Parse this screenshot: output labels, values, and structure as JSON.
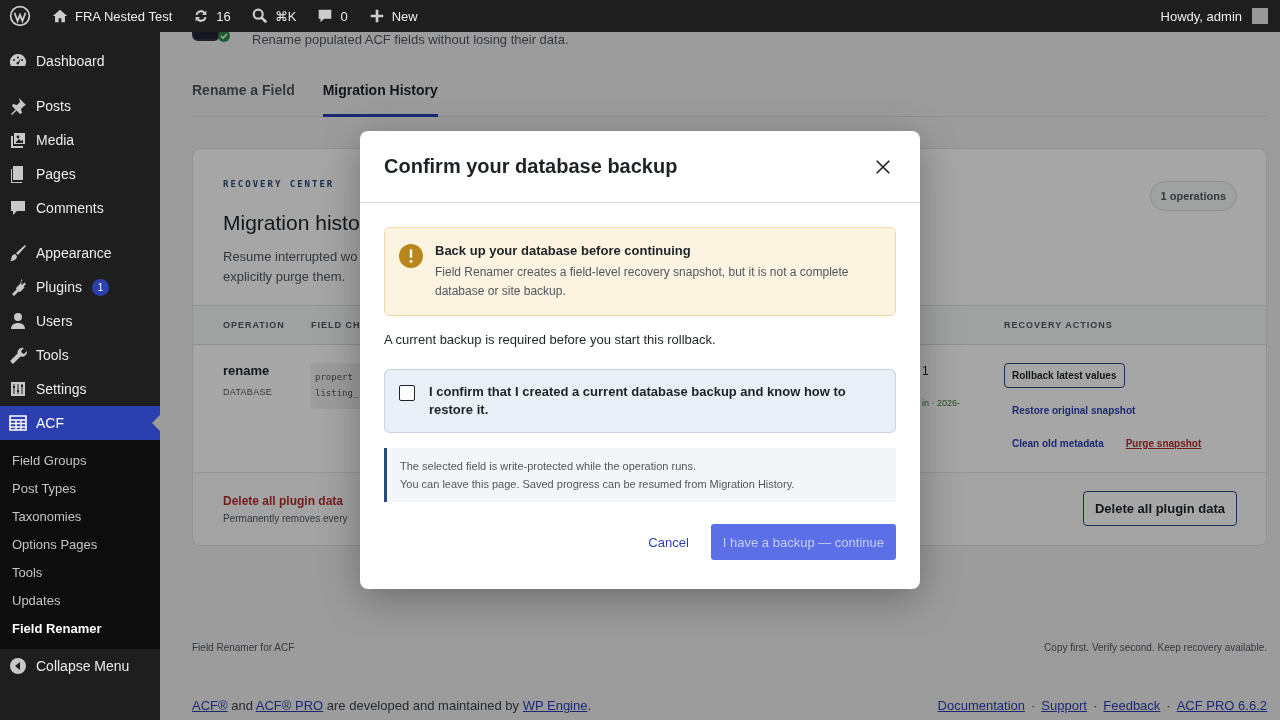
{
  "admin_bar": {
    "site_name": "FRA Nested Test",
    "updates": "16",
    "shortcut": "⌘K",
    "comments": "0",
    "new_label": "New",
    "greeting": "Howdy, admin"
  },
  "sidebar": {
    "groups": [
      [
        {
          "label": "Dashboard",
          "selected": false
        }
      ],
      [
        {
          "label": "Posts",
          "selected": false
        },
        {
          "label": "Media",
          "selected": false
        },
        {
          "label": "Pages",
          "selected": false
        },
        {
          "label": "Comments",
          "selected": false
        }
      ],
      [
        {
          "label": "Appearance",
          "selected": false
        },
        {
          "label": "Plugins",
          "selected": false,
          "badge": "1"
        },
        {
          "label": "Users",
          "selected": false
        },
        {
          "label": "Tools",
          "selected": false
        },
        {
          "label": "Settings",
          "selected": false
        },
        {
          "label": "ACF",
          "selected": true
        }
      ]
    ],
    "submenu": [
      {
        "label": "Field Groups",
        "selected": false
      },
      {
        "label": "Post Types",
        "selected": false
      },
      {
        "label": "Taxonomies",
        "selected": false
      },
      {
        "label": "Options Pages",
        "selected": false
      },
      {
        "label": "Tools",
        "selected": false
      },
      {
        "label": "Updates",
        "selected": false
      },
      {
        "label": "Field Renamer",
        "selected": true
      }
    ],
    "collapse_label": "Collapse Menu"
  },
  "page": {
    "subtitle": "Rename populated ACF fields without losing their data.",
    "tabs": [
      {
        "label": "Rename a Field",
        "selected": false
      },
      {
        "label": "Migration History",
        "selected": true
      }
    ],
    "card": {
      "eyebrow": "RECOVERY CENTER",
      "count": "1 operations",
      "title": "Migration histo",
      "description": [
        "Resume interrupted wo",
        "explicitly purge them."
      ],
      "columns": [
        "OPERATION",
        "FIELD CH",
        "",
        "RECOVERY ACTIONS"
      ],
      "rows": [
        {
          "operation": "rename",
          "storage": "DATABASE",
          "fields": [
            "propert",
            "listing_"
          ],
          "column_3": [
            {
              "text": "1",
              "kind": "plain"
            },
            {
              "text": "in · 2026-",
              "kind": "success"
            }
          ],
          "actions": [
            {
              "label": "Rollback latest values",
              "kind": "outline"
            },
            {
              "label": "Restore original snapshot",
              "kind": "link"
            },
            {
              "label": "Clean old metadata",
              "kind": "link"
            },
            {
              "label": "Purge snapshot",
              "kind": "danger"
            }
          ]
        }
      ],
      "danger_zone": {
        "title": "Delete all plugin data",
        "text": "Permanently removes every",
        "button": "Delete all plugin data"
      }
    },
    "footer": {
      "left": "Field Renamer for ACF",
      "right": "Copy first. Verify second. Keep recovery available."
    }
  },
  "credits": [
    {
      "text": "ACF®",
      "link": true
    },
    {
      "text": " and ",
      "link": false
    },
    {
      "text": "ACF® PRO",
      "link": true
    },
    {
      "text": " are developed and maintained by ",
      "link": false
    },
    {
      "text": "WP Engine",
      "link": true
    },
    {
      "text": ".",
      "link": false
    }
  ],
  "links": [
    {
      "text": "Documentation",
      "kind": "link"
    },
    {
      "text": "·",
      "kind": "sep"
    },
    {
      "text": "Support",
      "kind": "link"
    },
    {
      "text": "·",
      "kind": "sep"
    },
    {
      "text": "Feedback",
      "kind": "link"
    },
    {
      "text": "·",
      "kind": "sep"
    },
    {
      "text": "ACF PRO 6.6.2",
      "kind": "link"
    }
  ],
  "modal": {
    "title": "Confirm your database backup",
    "notice": {
      "title": "Back up your database before continuing",
      "text": "Field Renamer creates a field-level recovery snapshot, but it is not a complete database or site backup."
    },
    "requirement": "A current backup is required before you start this rollback.",
    "confirm": {
      "label": "I confirm that I created a current database backup and know how to restore it.",
      "checked": false
    },
    "info": [
      "The selected field is write-protected while the operation runs.",
      "You can leave this page. Saved progress can be resumed from Migration History."
    ],
    "cancel": "Cancel",
    "continue": {
      "label": "I have a backup — continue",
      "disabled": true
    }
  }
}
